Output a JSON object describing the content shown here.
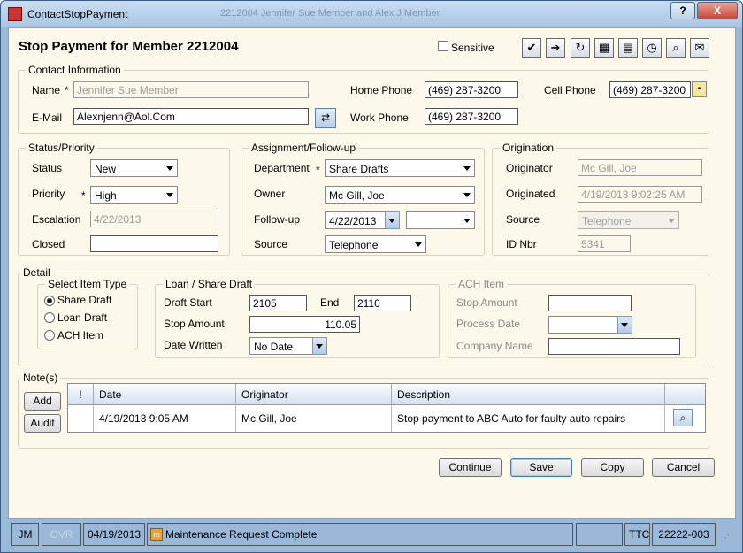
{
  "window": {
    "title": "ContactStopPayment",
    "ghost_title": "2212004 Jennifer Sue Member and Alex J Member",
    "help_label": "?",
    "close_label": "X"
  },
  "header": {
    "title": "Stop Payment for Member 2212004",
    "sensitive_label": "Sensitive",
    "sensitive_checked": false
  },
  "toolbar_icons": [
    "checklist-icon",
    "document-arrow-icon",
    "refresh-icon",
    "files-icon",
    "folder-icon",
    "clock-icon",
    "search-doc-icon",
    "mail-icon"
  ],
  "contact": {
    "title": "Contact Information",
    "name_label": "Name",
    "required_mark": "*",
    "name_value": "Jennifer Sue Member",
    "email_label": "E-Mail",
    "email_value": "Alexnjenn@Aol.Com",
    "home_label": "Home Phone",
    "home_value": "(469) 287-3200",
    "work_label": "Work Phone",
    "work_value": "(469) 287-3200",
    "cell_label": "Cell Phone",
    "cell_value": "(469) 287-3200"
  },
  "status": {
    "title": "Status/Priority",
    "status_label": "Status",
    "status_value": "New",
    "priority_label": "Priority",
    "priority_value": "High",
    "escalation_label": "Escalation",
    "escalation_value": "4/22/2013",
    "closed_label": "Closed",
    "closed_value": ""
  },
  "assignment": {
    "title": "Assignment/Follow-up",
    "department_label": "Department",
    "department_value": "Share Drafts",
    "owner_label": "Owner",
    "owner_value": "Mc Gill, Joe",
    "followup_label": "Follow-up",
    "followup_date": "4/22/2013",
    "followup_time": "",
    "source_label": "Source",
    "source_value": "Telephone"
  },
  "origination": {
    "title": "Origination",
    "originator_label": "Originator",
    "originator_value": "Mc Gill, Joe",
    "originated_label": "Originated",
    "originated_value": "4/19/2013 9:02:25 AM",
    "source_label": "Source",
    "source_value": "Telephone",
    "idnbr_label": "ID Nbr",
    "idnbr_value": "5341"
  },
  "detail": {
    "title": "Detail",
    "item_type_title": "Select Item Type",
    "item_types": [
      {
        "label": "Share Draft",
        "selected": true
      },
      {
        "label": "Loan Draft",
        "selected": false
      },
      {
        "label": "ACH Item",
        "selected": false
      }
    ],
    "loan_title": "Loan / Share Draft",
    "draft_start_label": "Draft Start",
    "draft_start_value": "2105",
    "end_label": "End",
    "end_value": "2110",
    "stop_amount_label": "Stop Amount",
    "stop_amount_value": "110.05",
    "date_written_label": "Date Written",
    "date_written_value": "No Date",
    "ach_title": "ACH Item",
    "ach_stop_amount_label": "Stop Amount",
    "ach_stop_amount_value": "",
    "process_date_label": "Process Date",
    "process_date_value": "",
    "company_name_label": "Company Name",
    "company_name_value": ""
  },
  "notes": {
    "title": "Note(s)",
    "add_label": "Add",
    "audit_label": "Audit",
    "columns": [
      "!",
      "Date",
      "Originator",
      "Description"
    ],
    "rows": [
      {
        "flag": "",
        "date": "4/19/2013 9:05 AM",
        "originator": "Mc Gill, Joe",
        "description": "Stop payment to ABC Auto for faulty auto repairs"
      }
    ]
  },
  "actions": {
    "continue_label": "Continue",
    "save_label": "Save",
    "copy_label": "Copy",
    "cancel_label": "Cancel"
  },
  "statusbar": {
    "user": "JM",
    "ovr": "OVR",
    "date": "04/19/2013",
    "message": "Maintenance Request Complete",
    "ttc": "TTC",
    "code": "22222-003"
  }
}
